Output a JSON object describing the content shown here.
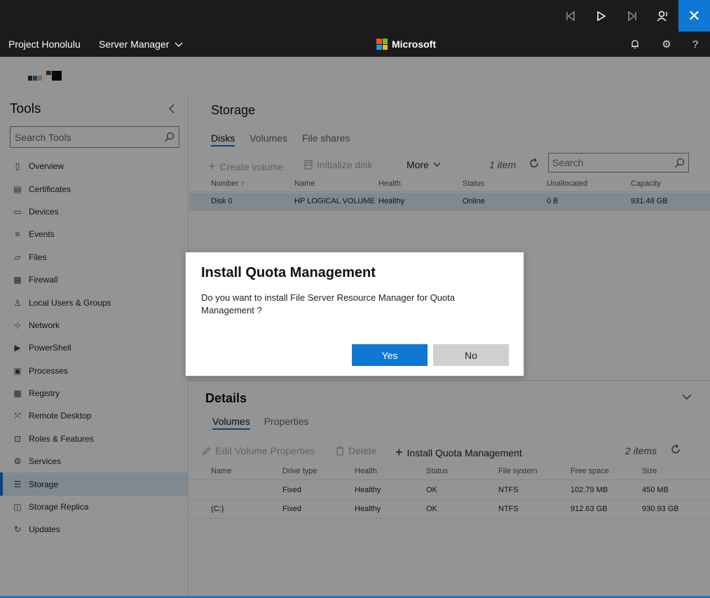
{
  "presentation_bar": {
    "controls": [
      {
        "name": "first-slide",
        "glyph": "|◁"
      },
      {
        "name": "play",
        "glyph": "▷"
      },
      {
        "name": "last-slide",
        "glyph": "▷|"
      },
      {
        "name": "narrator",
        "glyph": "ℜ"
      }
    ],
    "close_glyph": "✕"
  },
  "navbar": {
    "product": "Project Honolulu",
    "context": "Server Manager",
    "context_chevron": "⌄",
    "brand": "Microsoft",
    "brand_colors": [
      "#f25022",
      "#7fba00",
      "#00a4ef",
      "#ffb900"
    ],
    "icons": {
      "bell": "🔔",
      "gear": "⚙",
      "help": "?"
    }
  },
  "sidebar": {
    "title": "Tools",
    "collapse_glyph": "‹",
    "search_placeholder": "Search Tools",
    "items": [
      {
        "label": "Overview",
        "icon": "▯"
      },
      {
        "label": "Certificates",
        "icon": "▤"
      },
      {
        "label": "Devices",
        "icon": "▭"
      },
      {
        "label": "Events",
        "icon": "≡"
      },
      {
        "label": "Files",
        "icon": "▱"
      },
      {
        "label": "Firewall",
        "icon": "▦"
      },
      {
        "label": "Local Users & Groups",
        "icon": "♙"
      },
      {
        "label": "Network",
        "icon": "⊹"
      },
      {
        "label": "PowerShell",
        "icon": "▶"
      },
      {
        "label": "Processes",
        "icon": "▣"
      },
      {
        "label": "Registry",
        "icon": "▩"
      },
      {
        "label": "Remote Desktop",
        "icon": "⤧"
      },
      {
        "label": "Roles & Features",
        "icon": "⊡"
      },
      {
        "label": "Services",
        "icon": "⚙"
      },
      {
        "label": "Storage",
        "icon": "☰"
      },
      {
        "label": "Storage Replica",
        "icon": "◫"
      },
      {
        "label": "Updates",
        "icon": "↻"
      }
    ],
    "active_item": "Storage"
  },
  "storage": {
    "title": "Storage",
    "tabs": [
      "Disks",
      "Volumes",
      "File shares"
    ],
    "active_tab": "Disks",
    "toolbar": {
      "create_volume": "Create volume",
      "initialize_disk": "Initialize disk",
      "more": "More",
      "count": "1 item",
      "search_placeholder": "Search"
    },
    "columns": [
      "Number",
      "Name",
      "Health",
      "Status",
      "Unallocated",
      "Capacity"
    ],
    "sort_glyph": "↑",
    "rows": [
      [
        "Disk 0",
        "HP LOGICAL VOLUME",
        "Healthy",
        "Online",
        "0 B",
        "931.48 GB"
      ]
    ]
  },
  "details": {
    "title": "Details",
    "tabs": [
      "Volumes",
      "Properties"
    ],
    "active_tab": "Volumes",
    "toolbar": {
      "edit": "Edit Volume Properties",
      "delete": "Delete",
      "install": "Install Quota Management",
      "count": "2 items"
    },
    "columns": [
      "Name",
      "Drive type",
      "Health",
      "Status",
      "File system",
      "Free space",
      "Size"
    ],
    "rows": [
      [
        "",
        "Fixed",
        "Healthy",
        "OK",
        "NTFS",
        "102.79 MB",
        "450 MB"
      ],
      [
        "(C:)",
        "Fixed",
        "Healthy",
        "OK",
        "NTFS",
        "912.63 GB",
        "930.93 GB"
      ]
    ]
  },
  "dialog": {
    "title": "Install Quota Management",
    "message": "Do you want to install File Server Resource Manager for Quota Management ?",
    "yes": "Yes",
    "no": "No"
  },
  "colors": {
    "accent": "#0f78d4",
    "selected_row": "#dcecf7",
    "chrome": "#1b1b1b"
  }
}
